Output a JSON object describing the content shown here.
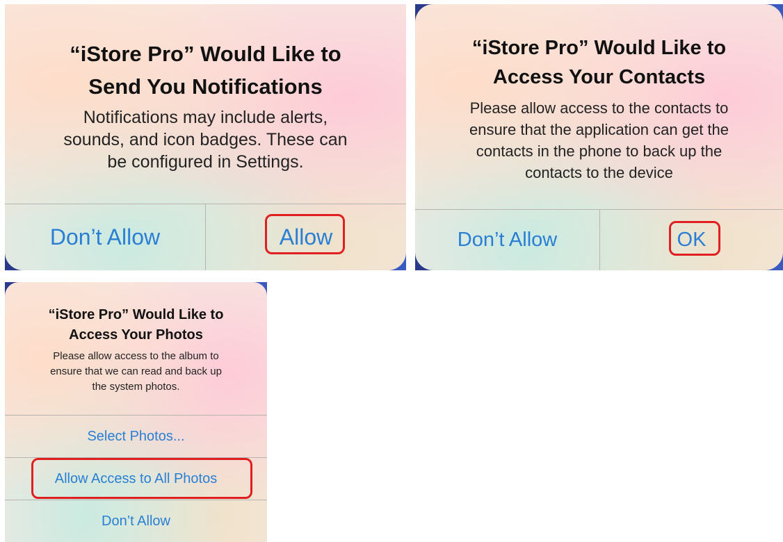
{
  "dialogs": {
    "notifications": {
      "title_line1": "“iStore Pro” Would Like to",
      "title_line2": "Send You Notifications",
      "message_line1": "Notifications may include alerts,",
      "message_line2": "sounds, and icon badges. These can",
      "message_line3": "be configured in Settings.",
      "buttons": {
        "deny": "Don’t Allow",
        "allow": "Allow"
      }
    },
    "contacts": {
      "title_line1": "“iStore Pro” Would Like to",
      "title_line2": "Access Your Contacts",
      "message_line1": "Please allow access to the contacts to",
      "message_line2": "ensure that the application can get the",
      "message_line3": "contacts in the phone to back up the",
      "message_line4": "contacts to the device",
      "buttons": {
        "deny": "Don’t Allow",
        "ok": "OK"
      }
    },
    "photos": {
      "title_line1": "“iStore Pro” Would Like to",
      "title_line2": "Access Your Photos",
      "message_line1": "Please allow access to the album to",
      "message_line2": "ensure that we can read and back up",
      "message_line3": "the system photos.",
      "buttons": {
        "select": "Select Photos...",
        "allow_all": "Allow Access to All Photos",
        "deny": "Don’t Allow"
      }
    }
  },
  "colors": {
    "button_text": "#2a7fd4",
    "highlight": "#e02020"
  }
}
